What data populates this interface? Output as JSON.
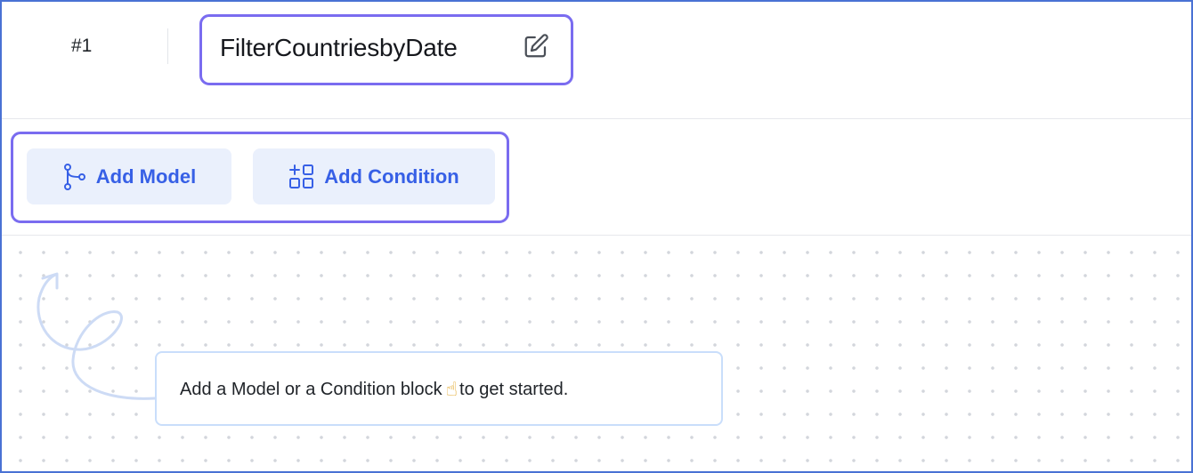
{
  "header": {
    "step_number": "#1",
    "title": "FilterCountriesbyDate",
    "edit_icon": "edit-icon"
  },
  "toolbar": {
    "add_model_label": "Add Model",
    "add_model_icon": "model-branch-icon",
    "add_condition_label": "Add Condition",
    "add_condition_icon": "add-condition-icon"
  },
  "canvas": {
    "hint_text_before": "Add a Model or a Condition block",
    "hint_emoji": "☝",
    "hint_text_after": "to get started."
  },
  "colors": {
    "accent": "#3760e6",
    "highlight_border": "#7a6cf0",
    "button_bg": "#eaf0fc",
    "frame_border": "#4a72d4"
  }
}
